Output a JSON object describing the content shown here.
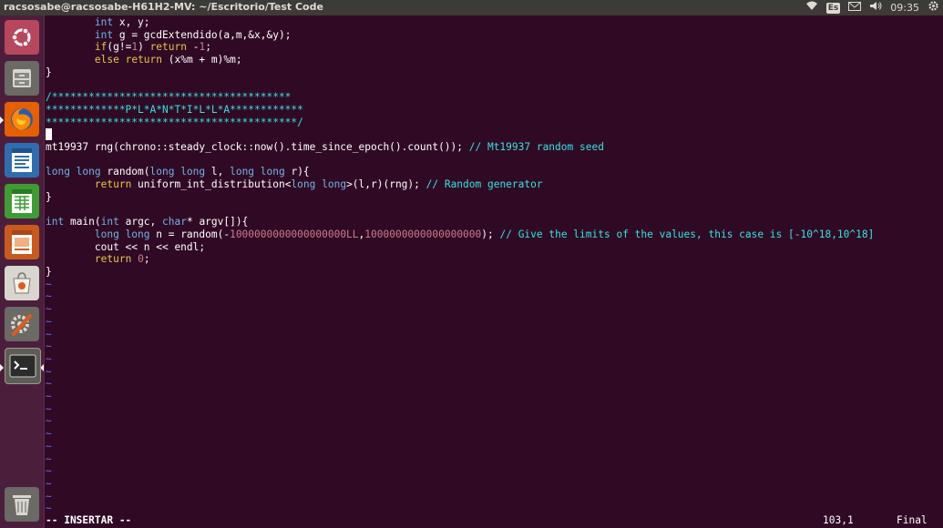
{
  "window": {
    "title": "racsosabe@racsosabe-H61H2-MV: ~/Escritorio/Test Code"
  },
  "tray": {
    "network_icon": "wifi-icon",
    "keyboard_layout": "Es",
    "mail_icon": "mail-icon",
    "volume_icon": "volume-icon",
    "clock": "09:35",
    "settings_icon": "gear-icon"
  },
  "launcher": {
    "items": [
      "ubuntu-dash",
      "files",
      "firefox",
      "libreoffice-writer",
      "libreoffice-calc",
      "libreoffice-impress",
      "software-center",
      "system-settings",
      "terminal",
      "trash"
    ]
  },
  "editor": {
    "lines": [
      {
        "n": 0,
        "segs": [
          [
            "        ",
            ""
          ],
          [
            "int",
            "type"
          ],
          [
            " x, y;",
            ""
          ]
        ]
      },
      {
        "n": 1,
        "segs": [
          [
            "        ",
            ""
          ],
          [
            "int",
            "type"
          ],
          [
            " g = gcdExtendido(a,m,&x,&y);",
            ""
          ]
        ]
      },
      {
        "n": 2,
        "segs": [
          [
            "        ",
            ""
          ],
          [
            "if",
            "kw"
          ],
          [
            "(g!=",
            ""
          ],
          [
            "1",
            "num"
          ],
          [
            ") ",
            ""
          ],
          [
            "return",
            "kw"
          ],
          [
            " -",
            ""
          ],
          [
            "1",
            "num"
          ],
          [
            ";",
            ""
          ]
        ]
      },
      {
        "n": 3,
        "segs": [
          [
            "        ",
            ""
          ],
          [
            "else",
            "kw"
          ],
          [
            " ",
            ""
          ],
          [
            "return",
            "kw"
          ],
          [
            " (x%m + m)%m;",
            ""
          ]
        ]
      },
      {
        "n": 4,
        "segs": [
          [
            "}",
            ""
          ]
        ]
      },
      {
        "n": 5,
        "segs": []
      },
      {
        "n": 6,
        "segs": [
          [
            "/***************************************",
            "cm"
          ]
        ]
      },
      {
        "n": 7,
        "segs": [
          [
            "*************P*L*A*N*T*I*L*L*A************",
            "cm"
          ]
        ]
      },
      {
        "n": 8,
        "segs": [
          [
            "*****************************************/",
            "cm"
          ]
        ]
      },
      {
        "n": 9,
        "segs": [],
        "cursor": true
      },
      {
        "n": 10,
        "segs": [
          [
            "mt19937 rng(chrono::steady_clock::now().time_since_epoch().count()); ",
            ""
          ],
          [
            "// Mt19937 random seed",
            "cm"
          ]
        ]
      },
      {
        "n": 11,
        "segs": []
      },
      {
        "n": 12,
        "segs": [
          [
            "long long",
            "type"
          ],
          [
            " random(",
            ""
          ],
          [
            "long long",
            "type"
          ],
          [
            " l, ",
            ""
          ],
          [
            "long long",
            "type"
          ],
          [
            " r){",
            ""
          ]
        ]
      },
      {
        "n": 13,
        "segs": [
          [
            "        ",
            ""
          ],
          [
            "return",
            "kw"
          ],
          [
            " uniform_int_distribution<",
            ""
          ],
          [
            "long long",
            "type"
          ],
          [
            ">(l,r)(rng); ",
            ""
          ],
          [
            "// Random generator",
            "cm"
          ]
        ]
      },
      {
        "n": 14,
        "segs": [
          [
            "}",
            ""
          ]
        ]
      },
      {
        "n": 15,
        "segs": []
      },
      {
        "n": 16,
        "segs": [
          [
            "int",
            "type"
          ],
          [
            " main(",
            ""
          ],
          [
            "int",
            "type"
          ],
          [
            " argc, ",
            ""
          ],
          [
            "char",
            "type"
          ],
          [
            "* argv[]){",
            ""
          ]
        ]
      },
      {
        "n": 17,
        "segs": [
          [
            "        ",
            ""
          ],
          [
            "long long",
            "type"
          ],
          [
            " n = random(-",
            ""
          ],
          [
            "1000000000000000000LL",
            "num"
          ],
          [
            ",",
            ""
          ],
          [
            "1000000000000000000",
            "num"
          ],
          [
            "); ",
            ""
          ],
          [
            "// Give the limits of the values, this case is [-10^18,10^18]",
            "cm"
          ]
        ]
      },
      {
        "n": 18,
        "segs": [
          [
            "        cout << n << endl;",
            ""
          ]
        ]
      },
      {
        "n": 19,
        "segs": [
          [
            "        ",
            ""
          ],
          [
            "return",
            "kw"
          ],
          [
            " ",
            ""
          ],
          [
            "0",
            "num"
          ],
          [
            ";",
            ""
          ]
        ]
      },
      {
        "n": 20,
        "segs": [
          [
            "}",
            ""
          ]
        ]
      }
    ],
    "tilde_char": "~",
    "tilde_count": 19
  },
  "status": {
    "mode": "-- INSERTAR --",
    "position": "103,1",
    "scroll": "Final"
  }
}
